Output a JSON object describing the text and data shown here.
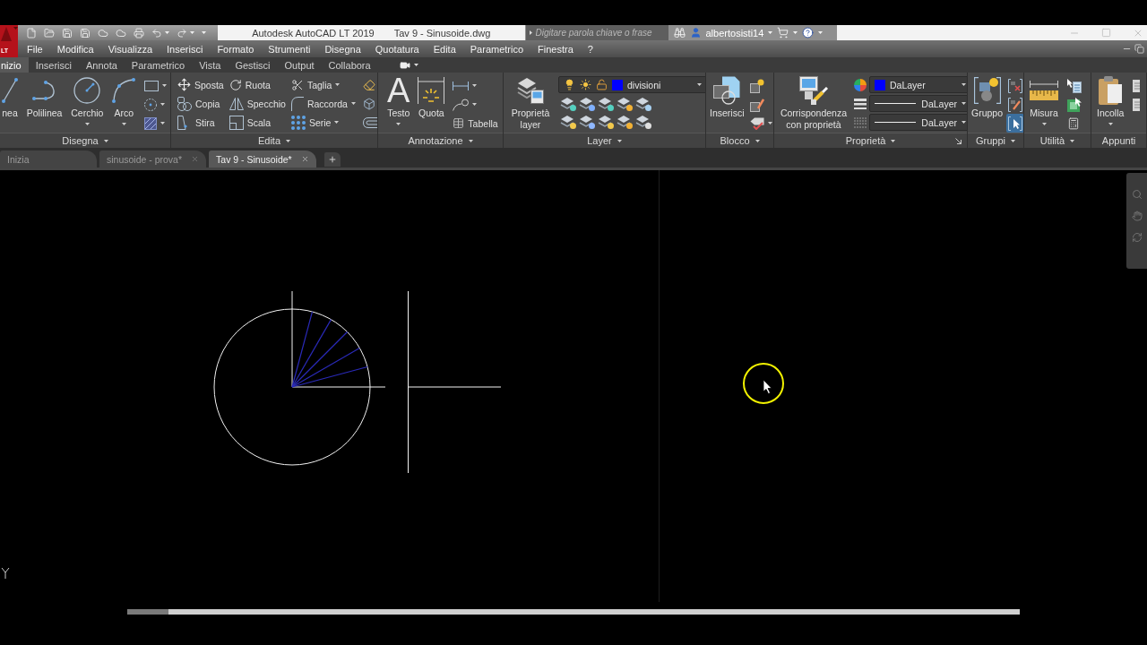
{
  "title_bar": {
    "logo": "LT",
    "app_title": "Autodesk AutoCAD LT 2019",
    "document_title": "Tav 9 - Sinusoide.dwg",
    "search": {
      "placeholder": "Digitare parola chiave o frase"
    },
    "user": "albertosisti14"
  },
  "menu_bar": {
    "items": [
      "File",
      "Modifica",
      "Visualizza",
      "Inserisci",
      "Formato",
      "Strumenti",
      "Disegna",
      "Quotatura",
      "Edita",
      "Parametrico",
      "Finestra",
      "?"
    ]
  },
  "ribbon": {
    "tabs": [
      {
        "label": "nizio",
        "selected": true
      },
      {
        "label": "Inserisci",
        "selected": false
      },
      {
        "label": "Annota",
        "selected": false
      },
      {
        "label": "Parametrico",
        "selected": false
      },
      {
        "label": "Vista",
        "selected": false
      },
      {
        "label": "Gestisci",
        "selected": false
      },
      {
        "label": "Output",
        "selected": false
      },
      {
        "label": "Collabora",
        "selected": false
      }
    ],
    "panels": [
      {
        "kind": "draw",
        "title": "Disegna",
        "menu": true,
        "large_tools": [
          {
            "label": "nea",
            "dropdown": false
          },
          {
            "label": "Polilinea",
            "dropdown": false
          },
          {
            "label": "Cerchio",
            "dropdown": true
          },
          {
            "label": "Arco",
            "dropdown": true
          }
        ],
        "small_tools": [
          {
            "dropdown": true
          },
          {
            "dropdown": true
          },
          {
            "dropdown": true
          }
        ]
      },
      {
        "kind": "modify",
        "title": "Edita",
        "menu": true,
        "tools": [
          {
            "label": "Sposta",
            "dropdown": false
          },
          {
            "label": "Ruota",
            "dropdown": false
          },
          {
            "label": "Taglia",
            "dropdown": true
          },
          {
            "label": "Copia",
            "dropdown": false
          },
          {
            "label": "Specchio",
            "dropdown": false
          },
          {
            "label": "Raccorda",
            "dropdown": true
          },
          {
            "label": "Stira",
            "dropdown": false
          },
          {
            "label": "Scala",
            "dropdown": false
          },
          {
            "label": "Serie",
            "dropdown": true
          }
        ]
      },
      {
        "kind": "annotation",
        "title": "Annotazione",
        "menu": true,
        "large_tools": [
          {
            "label": "Testo",
            "glyph": "A",
            "dropdown": true
          },
          {
            "label": "Quota",
            "dropdown": false
          }
        ],
        "small_tools": [
          {
            "dropdown": true
          },
          {
            "dropdown": true
          },
          {
            "label": "Tabella",
            "dropdown": false
          }
        ]
      },
      {
        "kind": "layer",
        "title": "Layer",
        "menu": true,
        "large_tools": [
          {
            "label": "Proprietà layer",
            "dropdown": false
          }
        ],
        "current_layer": {
          "name": "divisioni",
          "color": "#0000ff",
          "on": true,
          "frozen": false,
          "locked": false
        }
      },
      {
        "kind": "block",
        "title": "Blocco",
        "menu": true,
        "large_tools": [
          {
            "label": "Inserisci",
            "dropdown": false
          }
        ],
        "small_tools": [
          {
            "dropdown": false
          },
          {
            "dropdown": false
          },
          {
            "dropdown": true
          }
        ]
      },
      {
        "kind": "properties",
        "title": "Proprietà",
        "menu": true,
        "large_tools": [
          {
            "label": "Corrispondenza con proprietà",
            "dropdown": false
          }
        ],
        "combos": [
          {
            "kind": "color",
            "value": "DaLayer",
            "color": "#0000ff"
          },
          {
            "kind": "lineweight",
            "value": "DaLayer"
          },
          {
            "kind": "linetype",
            "value": "DaLayer"
          }
        ]
      },
      {
        "kind": "groups",
        "title": "Gruppi",
        "menu": true,
        "large_tools": [
          {
            "label": "Gruppo",
            "dropdown": false
          }
        ],
        "small_tools": [
          {
            "on": false
          },
          {
            "on": false
          },
          {
            "on": true
          }
        ]
      },
      {
        "kind": "utilities",
        "title": "Utilità",
        "menu": true,
        "large_tools": [
          {
            "label": "Misura",
            "dropdown": true
          }
        ]
      },
      {
        "kind": "clipboard",
        "title": "Appunti",
        "menu": false,
        "large_tools": [
          {
            "label": "Incolla",
            "dropdown": true
          }
        ]
      }
    ]
  },
  "file_tabs": [
    {
      "label": "Inizia",
      "selected": false,
      "closable": false
    },
    {
      "label": "sinusoide - prova*",
      "selected": false,
      "closable": true
    },
    {
      "label": "Tav 9 - Sinusoide*",
      "selected": true,
      "closable": true
    }
  ]
}
